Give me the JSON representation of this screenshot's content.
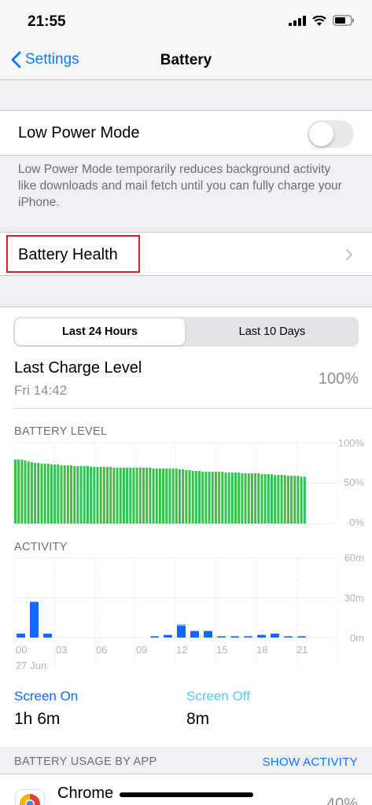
{
  "status": {
    "time": "21:55"
  },
  "nav": {
    "back_label": "Settings",
    "title": "Battery"
  },
  "low_power": {
    "label": "Low Power Mode",
    "enabled": false,
    "footnote": "Low Power Mode temporarily reduces background activity like downloads and mail fetch until you can fully charge your iPhone."
  },
  "battery_health": {
    "label": "Battery Health"
  },
  "segments": {
    "active": "Last 24 Hours",
    "inactive": "Last 10 Days"
  },
  "last_charge": {
    "title": "Last Charge Level",
    "time": "Fri 14:42",
    "value": "100%"
  },
  "colors": {
    "accent": "#0a7aff",
    "battery_green": "#33c24a",
    "activity_blue": "#1468ff",
    "screen_off_blue": "#5ac8fa"
  },
  "battery_level": {
    "title": "BATTERY LEVEL",
    "y_labels": [
      "100%",
      "50%",
      "0%"
    ]
  },
  "activity": {
    "title": "ACTIVITY",
    "y_labels": [
      "60m",
      "30m",
      "0m"
    ],
    "x_labels": [
      "00",
      "03",
      "06",
      "09",
      "12",
      "15",
      "18",
      "21"
    ],
    "date_label": "27 Jun"
  },
  "screen": {
    "on_label": "Screen On",
    "on_value": "1h 6m",
    "off_label": "Screen Off",
    "off_value": "8m"
  },
  "usage": {
    "title": "BATTERY USAGE BY APP",
    "action": "SHOW ACTIVITY"
  },
  "apps": [
    {
      "name": "Chrome",
      "percent": "40%"
    }
  ],
  "chart_data": [
    {
      "type": "bar",
      "title": "BATTERY LEVEL",
      "ylim": [
        0,
        100
      ],
      "y_ticks": [
        "0%",
        "50%",
        "100%"
      ],
      "values": [
        79,
        79,
        79,
        78,
        77,
        76,
        75,
        75,
        74,
        74,
        74,
        73,
        73,
        73,
        72,
        72,
        72,
        72,
        71,
        71,
        71,
        71,
        71,
        70,
        70,
        70,
        70,
        70,
        70,
        70,
        69,
        69,
        69,
        69,
        69,
        69,
        69,
        69,
        69,
        69,
        69,
        69,
        68,
        68,
        68,
        68,
        68,
        68,
        68,
        68,
        67,
        67,
        66,
        66,
        65,
        65,
        65,
        64,
        64,
        64,
        64,
        64,
        64,
        64,
        63,
        63,
        63,
        63,
        63,
        62,
        62,
        62,
        62,
        62,
        62,
        61,
        61,
        61,
        61,
        60,
        60,
        60,
        60,
        59,
        59,
        59,
        59,
        58,
        58
      ]
    },
    {
      "type": "bar",
      "title": "ACTIVITY",
      "ylim": [
        0,
        60
      ],
      "y_ticks": [
        "0m",
        "30m",
        "60m"
      ],
      "categories": [
        "00",
        "01",
        "02",
        "03",
        "04",
        "05",
        "06",
        "07",
        "08",
        "09",
        "10",
        "11",
        "12",
        "13",
        "14",
        "15",
        "16",
        "17",
        "18",
        "19",
        "20",
        "21"
      ],
      "series": [
        {
          "values": [
            3,
            27,
            3,
            0,
            0,
            0,
            0,
            0,
            0,
            0,
            1,
            2,
            9,
            5,
            5,
            1,
            1,
            1,
            2,
            3,
            1,
            1
          ]
        },
        {
          "values": [
            0,
            0,
            0,
            0,
            0,
            0,
            0,
            0,
            0,
            0,
            0,
            0,
            1,
            0,
            0,
            0,
            0,
            0,
            0,
            0,
            0,
            0
          ]
        }
      ]
    }
  ]
}
